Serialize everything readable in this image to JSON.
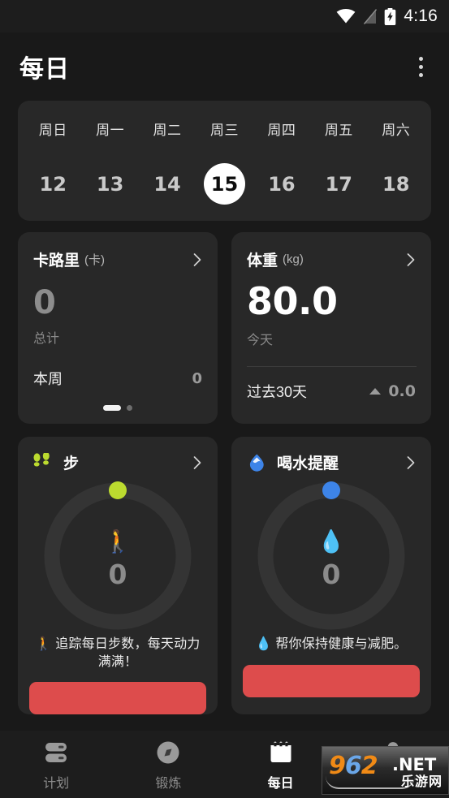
{
  "statusbar": {
    "time": "4:16",
    "icons": [
      "wifi-icon",
      "cellular-off-icon",
      "battery-charging-icon"
    ]
  },
  "appbar": {
    "title": "每日",
    "overflow_label": "overflow-menu"
  },
  "week": {
    "days": [
      {
        "dow": "周日",
        "num": "12",
        "selected": false
      },
      {
        "dow": "周一",
        "num": "13",
        "selected": false
      },
      {
        "dow": "周二",
        "num": "14",
        "selected": false
      },
      {
        "dow": "周三",
        "num": "15",
        "selected": true
      },
      {
        "dow": "周四",
        "num": "16",
        "selected": false
      },
      {
        "dow": "周五",
        "num": "17",
        "selected": false
      },
      {
        "dow": "周六",
        "num": "18",
        "selected": false
      }
    ]
  },
  "calories_card": {
    "title": "卡路里",
    "unit": "(卡)",
    "value": "0",
    "value_label": "总计",
    "row_key": "本周",
    "row_value": "0",
    "page_index": 1,
    "page_count": 2
  },
  "weight_card": {
    "title": "体重",
    "unit": "(kg)",
    "value": "80.0",
    "value_label": "今天",
    "trend_key": "过去30天",
    "trend_value": "0.0",
    "trend_direction": "up"
  },
  "steps_card": {
    "title": "步",
    "icon": "footprints-icon",
    "value": "0",
    "emoji": "🚶",
    "description": "🚶 追踪每日步数，每天动力满满！",
    "accent": "#bcdb2f",
    "progress_percent": 0,
    "cta_color": "#dd4c4c"
  },
  "water_card": {
    "title": "喝水提醒",
    "icon": "water-drop-icon",
    "value": "0",
    "emoji": "💧",
    "description": "💧 帮你保持健康与减肥。",
    "accent": "#3d84e8",
    "progress_percent": 0,
    "cta_color": "#dd4c4c"
  },
  "bottomnav": {
    "items": [
      {
        "label": "计划",
        "icon": "plans-icon",
        "active": false
      },
      {
        "label": "锻炼",
        "icon": "compass-icon",
        "active": false
      },
      {
        "label": "每日",
        "icon": "calendar-icon",
        "active": true
      },
      {
        "label": "",
        "icon": "profile-icon",
        "active": false
      }
    ]
  },
  "watermark": {
    "nine": "9",
    "six": "6",
    "two": "2",
    "net": ".NET",
    "cn": "乐游网"
  },
  "colors": {
    "page_bg": "#191919",
    "card_bg": "#282828",
    "accent_green": "#bcdb2f",
    "accent_blue": "#3d84e8",
    "cta_red": "#dd4c4c",
    "selected_day_bg": "#ffffff"
  }
}
